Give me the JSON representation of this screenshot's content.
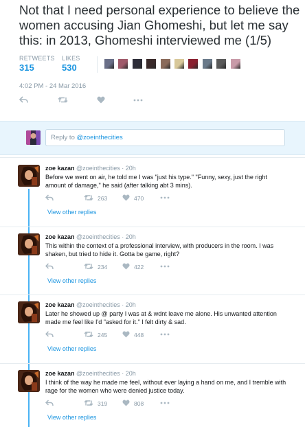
{
  "main_tweet": {
    "text": "Not that I need personal experience to believe the women accusing Jian Ghomeshi, but let me say this: in 2013, Ghomeshi interviewed me (1/5)",
    "retweets_label": "RETWEETS",
    "retweets_count": "315",
    "likes_label": "LIKES",
    "likes_count": "530",
    "timestamp": "4:02 PM - 24 Mar 2016",
    "liker_avatar_colors": [
      "#6a6f88",
      "#a05a6a",
      "#2c2c38",
      "#3a2a2a",
      "#8a6a5a",
      "#d8c89a",
      "#8a2030",
      "#6a7a8a",
      "#5a5a5a",
      "#c89aa8"
    ],
    "icons": {
      "reply": "reply-icon",
      "retweet": "retweet-icon",
      "like": "heart-icon",
      "more": "more-icon"
    }
  },
  "reply_box": {
    "prefix": "Reply to ",
    "mention": "@zoeinthecities"
  },
  "colors": {
    "accent": "#1b95e0",
    "thread_line": "#4ab3f4",
    "muted": "#8899a6",
    "reply_bar_bg": "#e8f5fd"
  },
  "replies": [
    {
      "name": "zoe kazan",
      "handle": "@zoeinthecities",
      "time": "· 20h",
      "text": "Before we went on air, he told me I was \"just his type.\" \"Funny, sexy, just the right amount of damage,\" he said (after talking abt 3 mins).",
      "retweets": "263",
      "likes": "470",
      "view_other": "View other replies"
    },
    {
      "name": "zoe kazan",
      "handle": "@zoeinthecities",
      "time": "· 20h",
      "text": "This within the context of a professional interview, with producers in the room. I was shaken, but tried to hide it. Gotta be game, right?",
      "retweets": "234",
      "likes": "422",
      "view_other": "View other replies"
    },
    {
      "name": "zoe kazan",
      "handle": "@zoeinthecities",
      "time": "· 20h",
      "text": "Later he showed up @ party I was at & wdnt leave me alone. His unwanted attention made me feel like I'd \"asked for it.\" I felt dirty & sad.",
      "retweets": "245",
      "likes": "448",
      "view_other": "View other replies"
    },
    {
      "name": "zoe kazan",
      "handle": "@zoeinthecities",
      "time": "· 20h",
      "text": "I think of the way he made me feel, without ever laying a hand on me, and I tremble with rage for the women who were denied justice today.",
      "retweets": "319",
      "likes": "808",
      "view_other": "View other replies"
    }
  ]
}
